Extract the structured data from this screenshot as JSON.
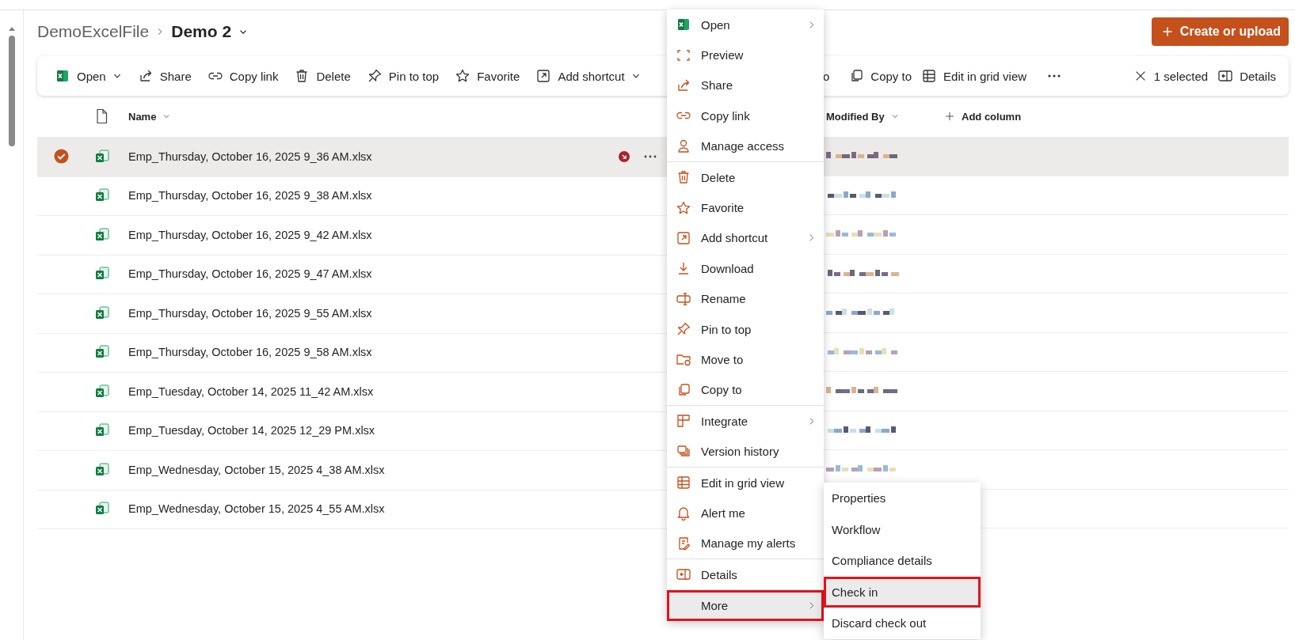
{
  "breadcrumb": {
    "parent": "DemoExcelFile",
    "current": "Demo 2"
  },
  "create_button": {
    "label": "Create or upload"
  },
  "toolbar": {
    "items": [
      {
        "label": "Open",
        "dropdown": true
      },
      {
        "label": "Share",
        "dropdown": false
      },
      {
        "label": "Copy link",
        "dropdown": false
      },
      {
        "label": "Delete",
        "dropdown": false
      },
      {
        "label": "Pin to top",
        "dropdown": false
      },
      {
        "label": "Favorite",
        "dropdown": false
      },
      {
        "label": "Add shortcut",
        "dropdown": true
      }
    ],
    "cut_item": {
      "label": "o"
    },
    "more_items": [
      {
        "label": "Copy to"
      },
      {
        "label": "Edit in grid view"
      }
    ],
    "selection": {
      "label": "1 selected"
    },
    "details": {
      "label": "Details"
    }
  },
  "columns": [
    {
      "label": "Name",
      "dropdown": true
    },
    {
      "label": "Modified By",
      "dropdown": true
    },
    {
      "label": "Add column",
      "dropdown": false
    }
  ],
  "rows": [
    {
      "name": "Emp_Thursday, October 16, 2025 9_36 AM.xlsx",
      "selected": true,
      "checked_out": true
    },
    {
      "name": "Emp_Thursday, October 16, 2025 9_38 AM.xlsx",
      "selected": false,
      "checked_out": false
    },
    {
      "name": "Emp_Thursday, October 16, 2025 9_42 AM.xlsx",
      "selected": false,
      "checked_out": false
    },
    {
      "name": "Emp_Thursday, October 16, 2025 9_47 AM.xlsx",
      "selected": false,
      "checked_out": false
    },
    {
      "name": "Emp_Thursday, October 16, 2025 9_55 AM.xlsx",
      "selected": false,
      "checked_out": false
    },
    {
      "name": "Emp_Thursday, October 16, 2025 9_58 AM.xlsx",
      "selected": false,
      "checked_out": false
    },
    {
      "name": "Emp_Tuesday, October 14, 2025 11_42 AM.xlsx",
      "selected": false,
      "checked_out": false
    },
    {
      "name": "Emp_Tuesday, October 14, 2025 12_29 PM.xlsx",
      "selected": false,
      "checked_out": false
    },
    {
      "name": "Emp_Wednesday, October 15, 2025 4_38 AM.xlsx",
      "selected": false,
      "checked_out": false
    },
    {
      "name": "Emp_Wednesday, October 15, 2025 4_55 AM.xlsx",
      "selected": false,
      "checked_out": false
    }
  ],
  "context_menu": {
    "groups": [
      [
        {
          "label": "Open",
          "submenu": true,
          "selected": false,
          "outlined": false
        },
        {
          "label": "Preview",
          "submenu": false,
          "selected": false,
          "outlined": false
        },
        {
          "label": "Share",
          "submenu": false,
          "selected": false,
          "outlined": false
        },
        {
          "label": "Copy link",
          "submenu": false,
          "selected": false,
          "outlined": false
        },
        {
          "label": "Manage access",
          "submenu": false,
          "selected": false,
          "outlined": false
        }
      ],
      [
        {
          "label": "Delete",
          "submenu": false,
          "selected": false,
          "outlined": false
        },
        {
          "label": "Favorite",
          "submenu": false,
          "selected": false,
          "outlined": false
        },
        {
          "label": "Add shortcut",
          "submenu": true,
          "selected": false,
          "outlined": false
        },
        {
          "label": "Download",
          "submenu": false,
          "selected": false,
          "outlined": false
        },
        {
          "label": "Rename",
          "submenu": false,
          "selected": false,
          "outlined": false
        },
        {
          "label": "Pin to top",
          "submenu": false,
          "selected": false,
          "outlined": false
        },
        {
          "label": "Move to",
          "submenu": false,
          "selected": false,
          "outlined": false
        },
        {
          "label": "Copy to",
          "submenu": false,
          "selected": false,
          "outlined": false
        }
      ],
      [
        {
          "label": "Integrate",
          "submenu": true,
          "selected": false,
          "outlined": false
        },
        {
          "label": "Version history",
          "submenu": false,
          "selected": false,
          "outlined": false
        }
      ],
      [
        {
          "label": "Edit in grid view",
          "submenu": false,
          "selected": false,
          "outlined": false
        },
        {
          "label": "Alert me",
          "submenu": false,
          "selected": false,
          "outlined": false
        },
        {
          "label": "Manage my alerts",
          "submenu": false,
          "selected": false,
          "outlined": false
        }
      ],
      [
        {
          "label": "Details",
          "submenu": false,
          "selected": false,
          "outlined": false
        }
      ],
      [
        {
          "label": "More",
          "submenu": true,
          "selected": true,
          "outlined": true
        }
      ]
    ]
  },
  "submenu": {
    "items": [
      {
        "label": "Properties",
        "selected": false,
        "outlined": false
      },
      {
        "label": "Workflow",
        "selected": false,
        "outlined": false
      },
      {
        "label": "Compliance details",
        "selected": false,
        "outlined": false
      },
      {
        "label": "Check in",
        "selected": true,
        "outlined": true
      },
      {
        "label": "Discard check out",
        "selected": false,
        "outlined": false
      }
    ]
  }
}
